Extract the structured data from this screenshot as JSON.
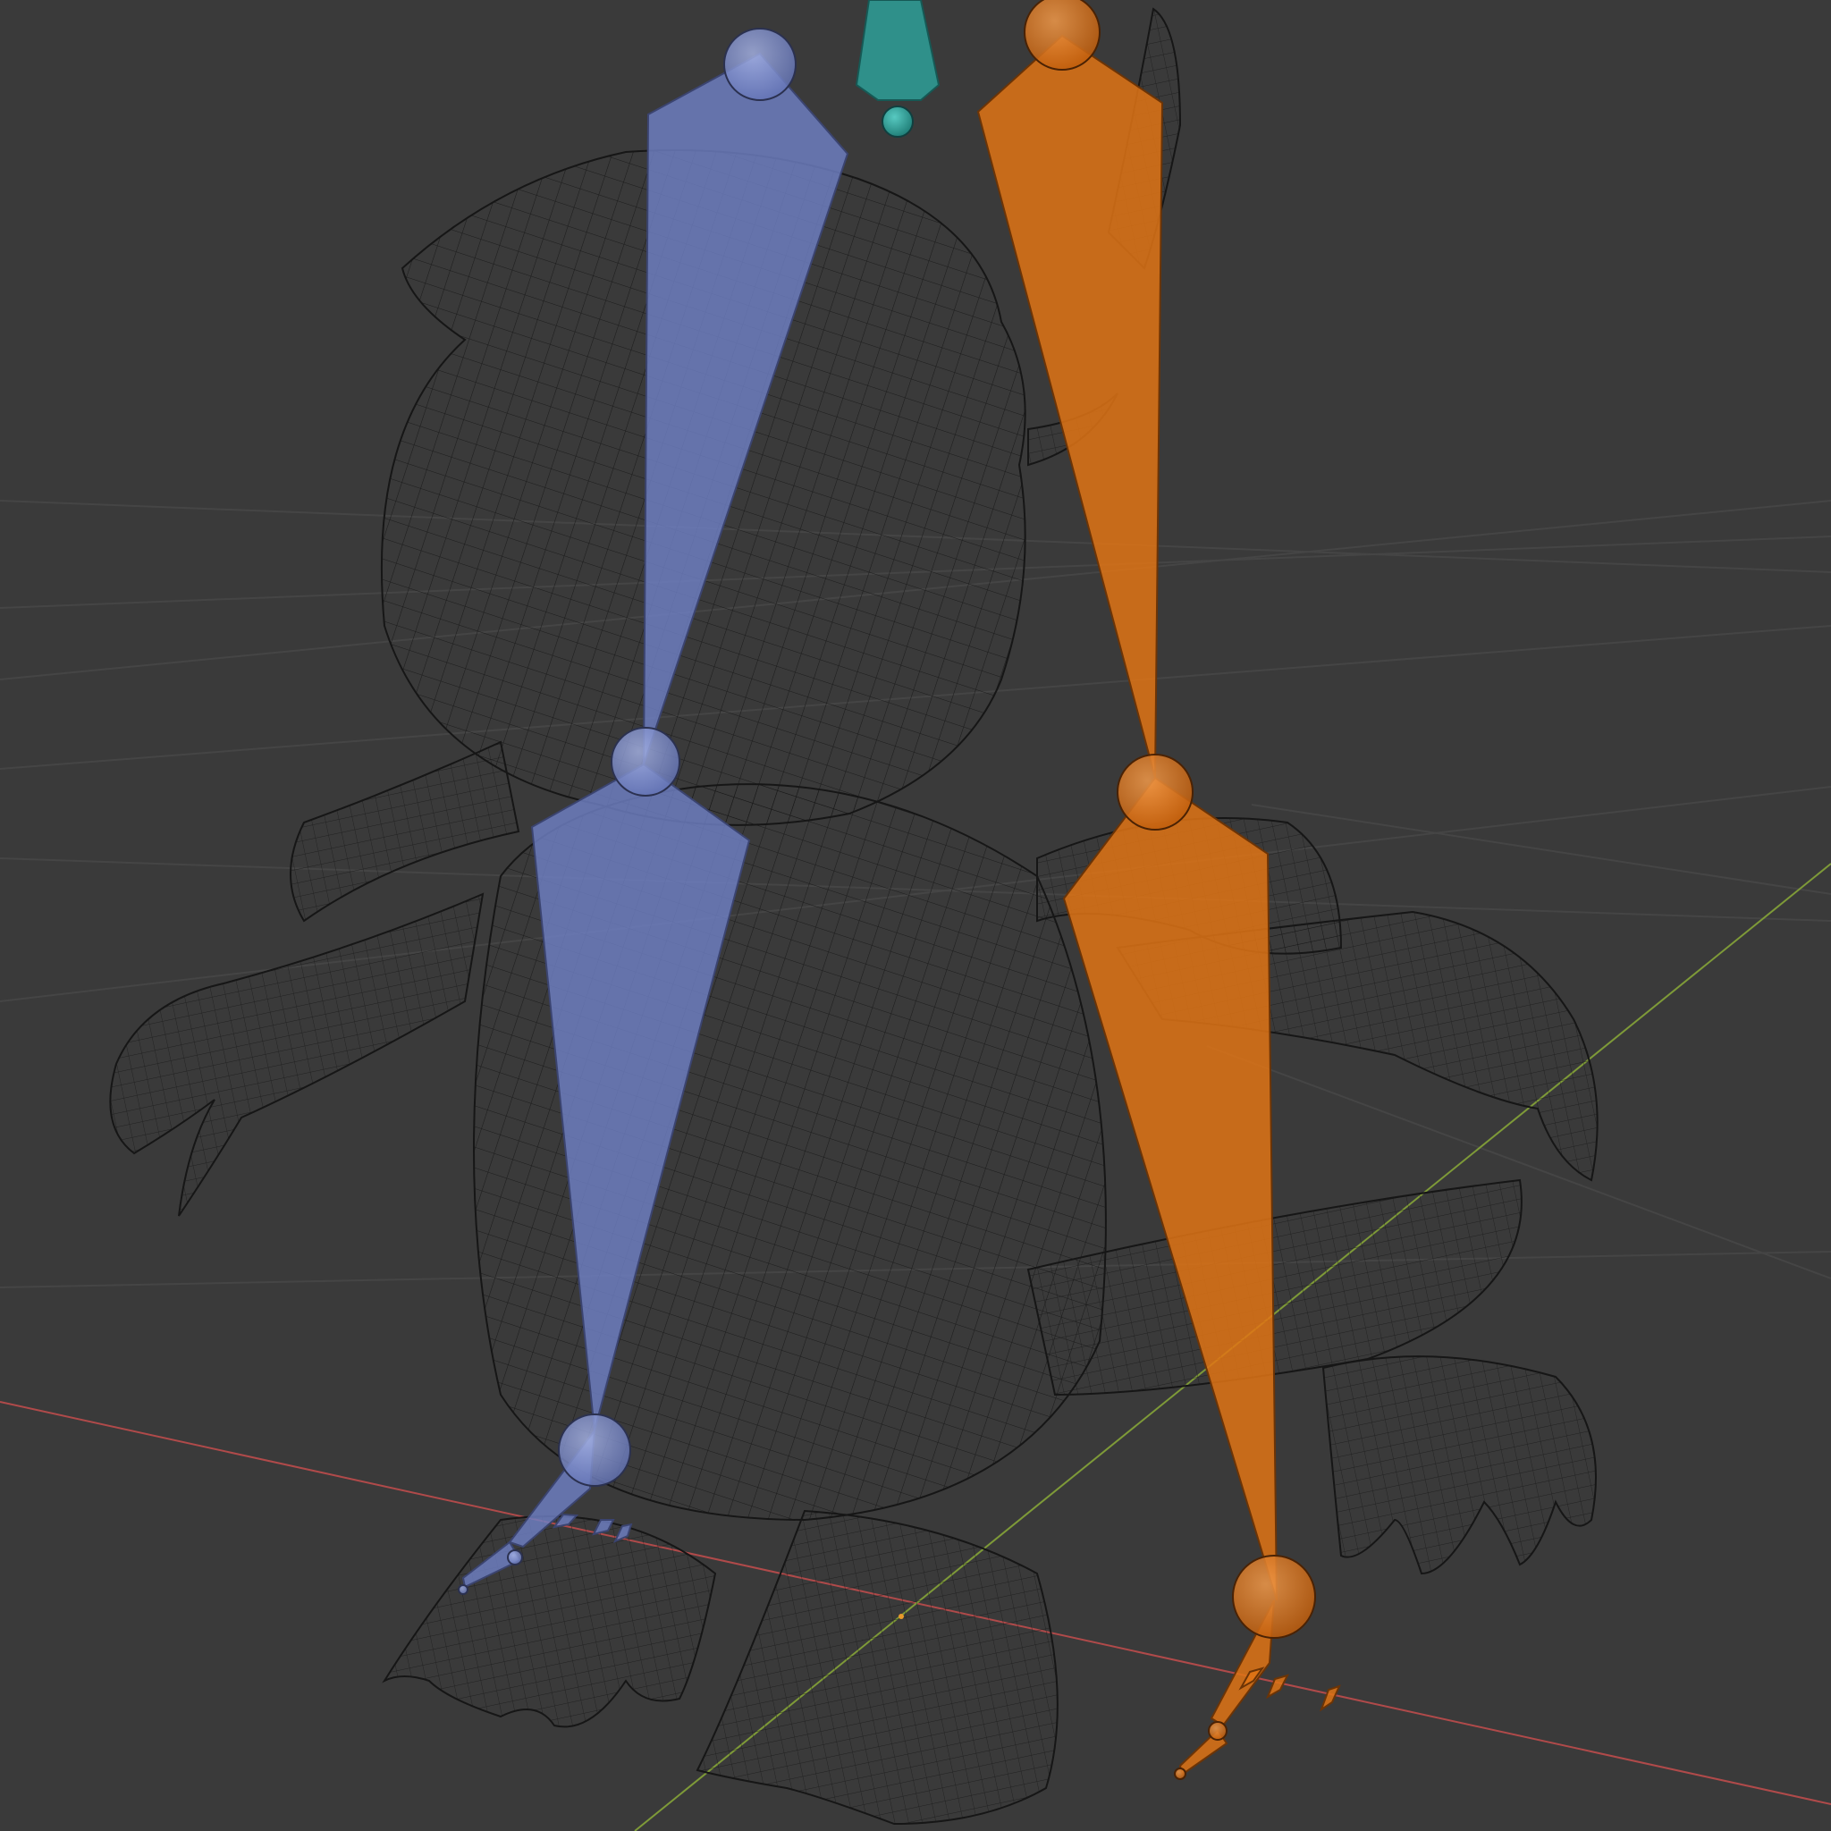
{
  "viewport": {
    "background": "#3a3a3a",
    "grid_color": "#454545",
    "x_axis_color": "#b04a4a",
    "y_axis_color": "#7e9a38",
    "wireframe_color": "#161616"
  },
  "armature": {
    "bone_colors": {
      "left_leg": "#6f80c4",
      "right_leg": "#e07415",
      "root": "#2f9a94"
    },
    "bones": [
      {
        "name": "root-bone",
        "color_key": "root"
      },
      {
        "name": "left-thigh-bone",
        "color_key": "left_leg"
      },
      {
        "name": "left-shin-bone",
        "color_key": "left_leg"
      },
      {
        "name": "left-foot-bone",
        "color_key": "left_leg"
      },
      {
        "name": "right-thigh-bone",
        "color_key": "right_leg"
      },
      {
        "name": "right-shin-bone",
        "color_key": "right_leg"
      },
      {
        "name": "right-foot-bone",
        "color_key": "right_leg"
      }
    ]
  },
  "mesh": {
    "object": "creature-wireframe-mesh",
    "display": "wireframe"
  }
}
